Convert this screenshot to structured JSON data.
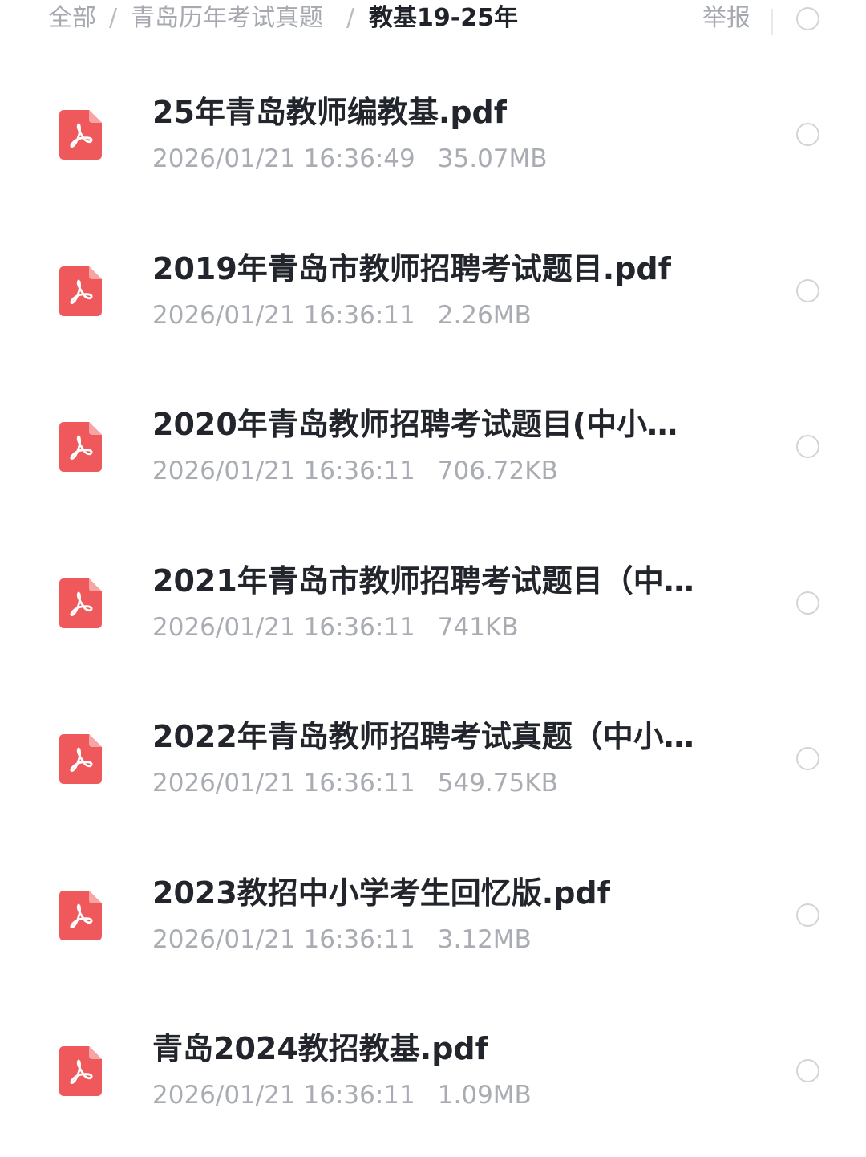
{
  "breadcrumb": {
    "items": [
      "全部",
      "青岛历年考试真题"
    ],
    "separator": "/",
    "current": "教基19-25年"
  },
  "header": {
    "report_label": "举报"
  },
  "icons": {
    "file_type_icon": "pdf-file-icon",
    "select_icon": "radio-circle-icon"
  },
  "colors": {
    "pdf_icon": "#f0595c",
    "title_text": "#22252b",
    "meta_text": "#a9acb2"
  },
  "files": [
    {
      "name": "25年青岛教师编教基.pdf",
      "date": "2026/01/21 16:36:49",
      "size": "35.07MB"
    },
    {
      "name": "2019年青岛市教师招聘考试题目.pdf",
      "date": "2026/01/21 16:36:11",
      "size": "2.26MB"
    },
    {
      "name": "2020年青岛教师招聘考试题目(中小…",
      "date": "2026/01/21 16:36:11",
      "size": "706.72KB"
    },
    {
      "name": "2021年青岛市教师招聘考试题目（中…",
      "date": "2026/01/21 16:36:11",
      "size": "741KB"
    },
    {
      "name": "2022年青岛教师招聘考试真题（中小…",
      "date": "2026/01/21 16:36:11",
      "size": "549.75KB"
    },
    {
      "name": "2023教招中小学考生回忆版.pdf",
      "date": "2026/01/21 16:36:11",
      "size": "3.12MB"
    },
    {
      "name": "青岛2024教招教基.pdf",
      "date": "2026/01/21 16:36:11",
      "size": "1.09MB"
    }
  ]
}
